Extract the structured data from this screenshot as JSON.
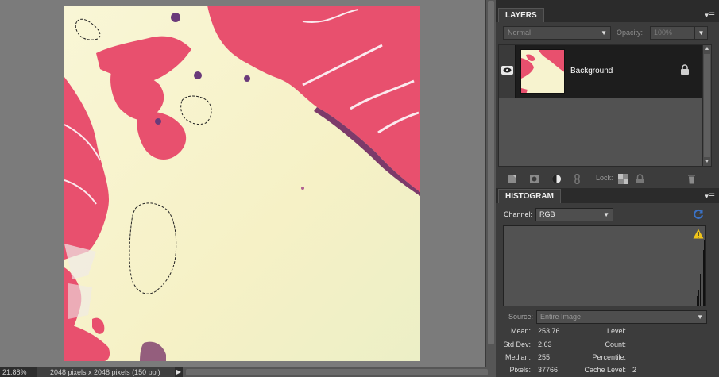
{
  "status_bar": {
    "zoom": "21.88%",
    "doc_info": "2048 pixels x 2048 pixels (150 ppi)"
  },
  "layers_panel": {
    "tab_label": "LAYERS",
    "blend_mode": "Normal",
    "opacity_label": "Opacity:",
    "opacity_value": "100%",
    "layers": [
      {
        "name": "Background",
        "visible": true,
        "locked": true
      }
    ],
    "lock_label": "Lock:"
  },
  "histogram_panel": {
    "tab_label": "HISTOGRAM",
    "channel_label": "Channel:",
    "channel_value": "RGB",
    "source_label": "Source:",
    "source_value": "Entire Image",
    "stats_left": [
      {
        "label": "Mean:",
        "value": "253.76"
      },
      {
        "label": "Std Dev:",
        "value": "2.63"
      },
      {
        "label": "Median:",
        "value": "255"
      },
      {
        "label": "Pixels:",
        "value": "37766"
      }
    ],
    "stats_right": [
      {
        "label": "Level:",
        "value": ""
      },
      {
        "label": "Count:",
        "value": ""
      },
      {
        "label": "Percentile:",
        "value": ""
      },
      {
        "label": "Cache Level:",
        "value": "2"
      }
    ]
  },
  "colors": {
    "tissue_pink": "#e8506e",
    "background_cream": "#f7f3cf",
    "warning_yellow": "#f0c419",
    "panel_dark": "#3c3c3c"
  }
}
